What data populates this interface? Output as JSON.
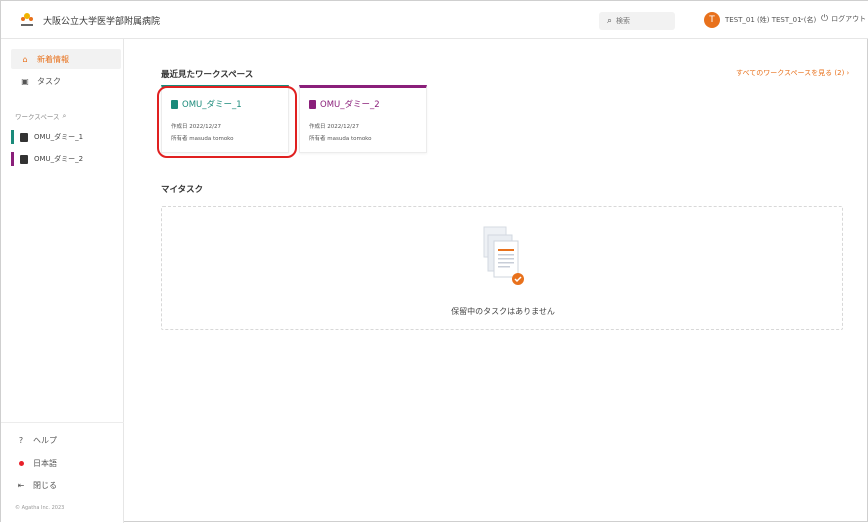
{
  "header": {
    "org_name": "大阪公立大学医学部附属病院",
    "search_placeholder": "検索",
    "avatar_initial": "T",
    "user_name": "TEST_01 (姓) TEST_01 (名)",
    "logout_label": "ログアウト"
  },
  "sidebar": {
    "nav": [
      {
        "label": "新着情報",
        "icon": "home-icon",
        "active": true
      },
      {
        "label": "タスク",
        "icon": "calendar-icon",
        "active": false
      }
    ],
    "workspace_heading": "ワークスペース",
    "workspaces": [
      {
        "label": "OMU_ダミー_1",
        "color": "#1a8a7a"
      },
      {
        "label": "OMU_ダミー_2",
        "color": "#8a1f7a"
      }
    ],
    "footer": {
      "help": "ヘルプ",
      "language": "日本語",
      "close": "閉じる",
      "copyright": "© Agatha Inc. 2023"
    }
  },
  "main": {
    "recent_title": "最近見たワークスペース",
    "see_all": "すべてのワークスペースを見る (2) ›",
    "cards": [
      {
        "title": "OMU_ダミー_1",
        "created": "作成日 2022/12/27",
        "owner": "所有者 masuda tomoko",
        "color": "#1a8a7a"
      },
      {
        "title": "OMU_ダミー_2",
        "created": "作成日 2022/12/27",
        "owner": "所有者 masuda tomoko",
        "color": "#8a1f7a"
      }
    ],
    "my_tasks_title": "マイタスク",
    "empty_tasks": "保留中のタスクはありません"
  }
}
